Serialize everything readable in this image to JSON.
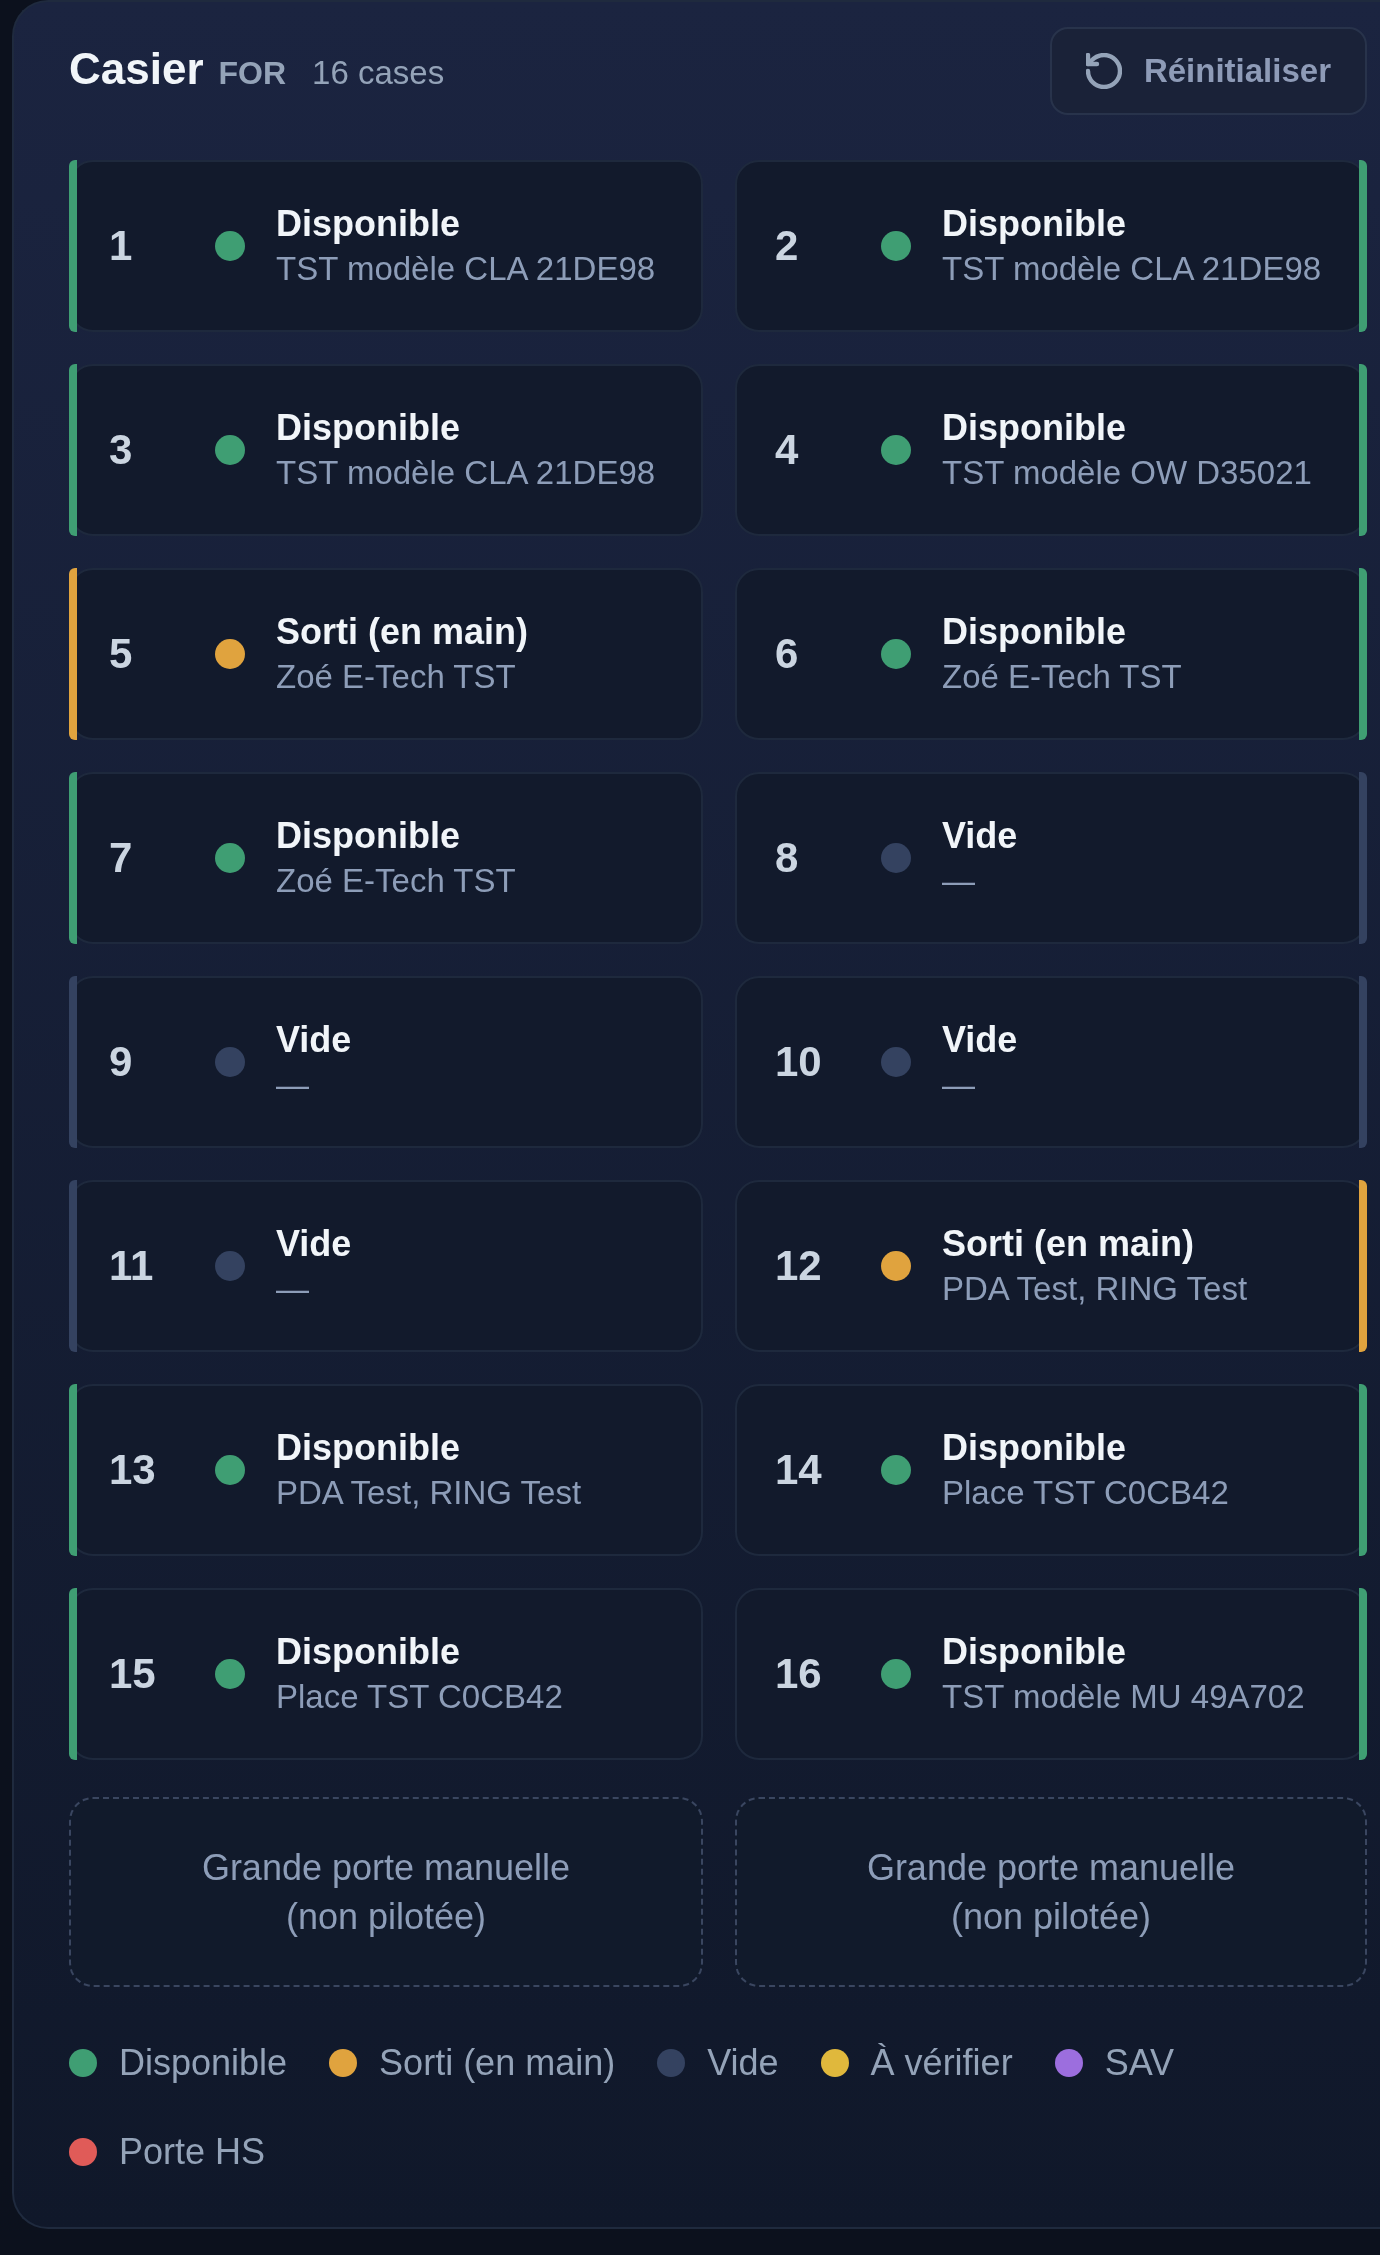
{
  "header": {
    "title": "Casier",
    "site": "FOR",
    "count": "16 cases"
  },
  "reset_button": {
    "label": "Réinitialiser"
  },
  "lockers": [
    {
      "number": "1",
      "status": "Disponible",
      "content": "TST modèle CLA 21DE98",
      "color": "#3f9e73"
    },
    {
      "number": "2",
      "status": "Disponible",
      "content": "TST modèle CLA 21DE98",
      "color": "#3f9e73"
    },
    {
      "number": "3",
      "status": "Disponible",
      "content": "TST modèle CLA 21DE98",
      "color": "#3f9e73"
    },
    {
      "number": "4",
      "status": "Disponible",
      "content": "TST modèle OW D35021",
      "color": "#3f9e73"
    },
    {
      "number": "5",
      "status": "Sorti (en main)",
      "content": "Zoé E-Tech TST",
      "color": "#e0a33e"
    },
    {
      "number": "6",
      "status": "Disponible",
      "content": "Zoé E-Tech TST",
      "color": "#3f9e73"
    },
    {
      "number": "7",
      "status": "Disponible",
      "content": "Zoé E-Tech TST",
      "color": "#3f9e73"
    },
    {
      "number": "8",
      "status": "Vide",
      "content": "—",
      "color": "#344260"
    },
    {
      "number": "9",
      "status": "Vide",
      "content": "—",
      "color": "#344260"
    },
    {
      "number": "10",
      "status": "Vide",
      "content": "—",
      "color": "#344260"
    },
    {
      "number": "11",
      "status": "Vide",
      "content": "—",
      "color": "#344260"
    },
    {
      "number": "12",
      "status": "Sorti (en main)",
      "content": "PDA Test, RING Test",
      "color": "#e0a33e"
    },
    {
      "number": "13",
      "status": "Disponible",
      "content": "PDA Test, RING Test",
      "color": "#3f9e73"
    },
    {
      "number": "14",
      "status": "Disponible",
      "content": "Place TST C0CB42",
      "color": "#3f9e73"
    },
    {
      "number": "15",
      "status": "Disponible",
      "content": "Place TST C0CB42",
      "color": "#3f9e73"
    },
    {
      "number": "16",
      "status": "Disponible",
      "content": "TST modèle MU 49A702",
      "color": "#3f9e73"
    }
  ],
  "doors": [
    {
      "label": "Grande porte manuelle (non pilotée)"
    },
    {
      "label": "Grande porte manuelle (non pilotée)"
    }
  ],
  "legend": [
    {
      "label": "Disponible",
      "color": "#3f9e73"
    },
    {
      "label": "Sorti (en main)",
      "color": "#e0a33e"
    },
    {
      "label": "Vide",
      "color": "#344260"
    },
    {
      "label": "À vérifier",
      "color": "#e0b83c"
    },
    {
      "label": "SAV",
      "color": "#9c6ede"
    },
    {
      "label": "Porte HS",
      "color": "#e05b58"
    }
  ]
}
